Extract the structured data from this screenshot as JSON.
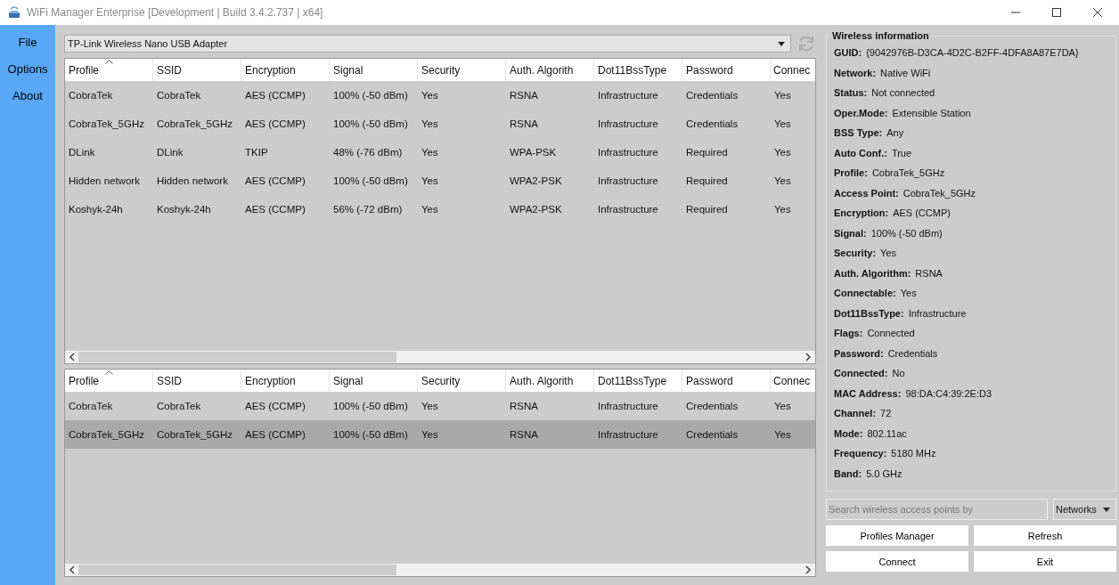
{
  "window": {
    "title": "WiFi Manager Enterprise [Development | Build 3.4.2.737 | x64]"
  },
  "sidebar": {
    "items": [
      {
        "label": "File"
      },
      {
        "label": "Options"
      },
      {
        "label": "About"
      }
    ]
  },
  "adapter": {
    "value": "TP-Link Wireless Nano USB Adapter"
  },
  "tables": [
    {
      "columns": [
        {
          "label": "Profile",
          "sorted": true
        },
        {
          "label": "SSID",
          "sorted": false
        },
        {
          "label": "Encryption",
          "sorted": false
        },
        {
          "label": "Signal",
          "sorted": false
        },
        {
          "label": "Security",
          "sorted": false
        },
        {
          "label": "Auth. Algorith",
          "sorted": false
        },
        {
          "label": "Dot11BssType",
          "sorted": false
        },
        {
          "label": "Password",
          "sorted": false
        },
        {
          "label": "Connec",
          "sorted": false
        }
      ],
      "rows": [
        {
          "selected": false,
          "cells": [
            "CobraTek",
            "CobraTek",
            "AES (CCMP)",
            "100% (-50 dBm)",
            "Yes",
            "RSNA",
            "Infrastructure",
            "Credentials",
            "Yes"
          ]
        },
        {
          "selected": false,
          "cells": [
            "CobraTek_5GHz",
            "CobraTek_5GHz",
            "AES (CCMP)",
            "100% (-50 dBm)",
            "Yes",
            "RSNA",
            "Infrastructure",
            "Credentials",
            "Yes"
          ]
        },
        {
          "selected": false,
          "cells": [
            "DLink",
            "DLink",
            "TKIP",
            "48% (-76 dBm)",
            "Yes",
            "WPA-PSK",
            "Infrastructure",
            "Required",
            "Yes"
          ]
        },
        {
          "selected": false,
          "cells": [
            "Hidden network",
            "Hidden network",
            "AES (CCMP)",
            "100% (-50 dBm)",
            "Yes",
            "WPA2-PSK",
            "Infrastructure",
            "Required",
            "Yes"
          ]
        },
        {
          "selected": false,
          "cells": [
            "Koshyk-24h",
            "Koshyk-24h",
            "AES (CCMP)",
            "56% (-72 dBm)",
            "Yes",
            "WPA2-PSK",
            "Infrastructure",
            "Required",
            "Yes"
          ]
        }
      ]
    },
    {
      "columns": [
        {
          "label": "Profile",
          "sorted": true
        },
        {
          "label": "SSID",
          "sorted": false
        },
        {
          "label": "Encryption",
          "sorted": false
        },
        {
          "label": "Signal",
          "sorted": false
        },
        {
          "label": "Security",
          "sorted": false
        },
        {
          "label": "Auth. Algorith",
          "sorted": false
        },
        {
          "label": "Dot11BssType",
          "sorted": false
        },
        {
          "label": "Password",
          "sorted": false
        },
        {
          "label": "Connec",
          "sorted": false
        }
      ],
      "rows": [
        {
          "selected": false,
          "cells": [
            "CobraTek",
            "CobraTek",
            "AES (CCMP)",
            "100% (-50 dBm)",
            "Yes",
            "RSNA",
            "Infrastructure",
            "Credentials",
            "Yes"
          ]
        },
        {
          "selected": true,
          "cells": [
            "CobraTek_5GHz",
            "CobraTek_5GHz",
            "AES (CCMP)",
            "100% (-50 dBm)",
            "Yes",
            "RSNA",
            "Infrastructure",
            "Credentials",
            "Yes"
          ]
        }
      ]
    }
  ],
  "info": {
    "title": "Wireless information",
    "items": [
      {
        "label": "GUID:",
        "value": "{9042976B-D3CA-4D2C-B2FF-4DFA8A87E7DA}"
      },
      {
        "label": "Network:",
        "value": "Native WiFi"
      },
      {
        "label": "Status:",
        "value": "Not connected"
      },
      {
        "label": "Oper.Mode:",
        "value": "Extensible Station"
      },
      {
        "label": "BSS Type:",
        "value": "Any"
      },
      {
        "label": "Auto Conf.:",
        "value": "True"
      },
      {
        "label": "Profile:",
        "value": "CobraTek_5GHz"
      },
      {
        "label": "Access Point:",
        "value": "CobraTek_5GHz"
      },
      {
        "label": "Encryption:",
        "value": "AES (CCMP)"
      },
      {
        "label": "Signal:",
        "value": "100% (-50 dBm)"
      },
      {
        "label": "Security:",
        "value": "Yes"
      },
      {
        "label": "Auth. Algorithm:",
        "value": "RSNA"
      },
      {
        "label": "Connectable:",
        "value": "Yes"
      },
      {
        "label": "Dot11BssType:",
        "value": "Infrastructure"
      },
      {
        "label": "Flags:",
        "value": "Connected"
      },
      {
        "label": "Password:",
        "value": "Credentials"
      },
      {
        "label": "Connected:",
        "value": "No"
      },
      {
        "label": "MAC Address:",
        "value": "98:DA:C4:39:2E:D3"
      },
      {
        "label": "Channel:",
        "value": "72"
      },
      {
        "label": "Mode:",
        "value": "802.11ac"
      },
      {
        "label": "Frequency:",
        "value": "5180 MHz"
      },
      {
        "label": "Band:",
        "value": "5.0 GHz"
      }
    ]
  },
  "search": {
    "placeholder": "Search wireless access points by",
    "filter": "Networks"
  },
  "buttons": [
    "Profiles Manager",
    "Refresh",
    "Connect",
    "Exit"
  ]
}
